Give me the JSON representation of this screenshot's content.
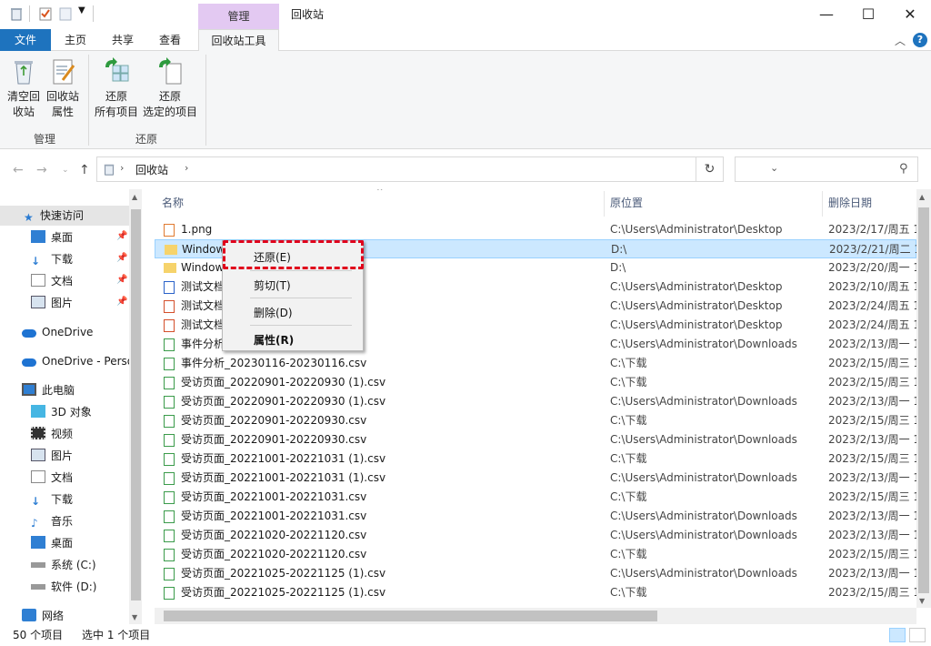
{
  "window": {
    "title": "回收站",
    "context_tab_header": "管理",
    "minimize": "—",
    "maximize": "☐",
    "close": "✕"
  },
  "ribbon_tabs": [
    {
      "label": "文件"
    },
    {
      "label": "主页"
    },
    {
      "label": "共享"
    },
    {
      "label": "查看"
    },
    {
      "label": "回收站工具"
    }
  ],
  "ribbon": {
    "empty_bin": [
      "清空回",
      "收站"
    ],
    "bin_props": [
      "回收站",
      "属性"
    ],
    "restore_all": [
      "还原",
      "所有项目"
    ],
    "restore_selected": [
      "还原",
      "选定的项目"
    ],
    "group_manage": "管理",
    "group_restore": "还原"
  },
  "address": {
    "crumb": "回收站"
  },
  "nav": {
    "quick_access": "快速访问",
    "desktop": "桌面",
    "downloads": "下载",
    "documents": "文档",
    "pictures": "图片",
    "onedrive": "OneDrive",
    "onedrive_personal": "OneDrive - Personal",
    "this_pc": "此电脑",
    "objects3d": "3D 对象",
    "videos": "视频",
    "pictures2": "图片",
    "documents2": "文档",
    "downloads2": "下载",
    "music": "音乐",
    "desktop2": "桌面",
    "drive_c": "系统 (C:)",
    "drive_d": "软件 (D:)",
    "network": "网络"
  },
  "columns": {
    "name": "名称",
    "location": "原位置",
    "date": "删除日期"
  },
  "files": [
    {
      "name": "1.png",
      "loc": "C:\\Users\\Administrator\\Desktop",
      "date": "2023/2/17/周五 1"
    },
    {
      "name": "Windows",
      "loc": "D:\\",
      "date": "2023/2/21/周二 1"
    },
    {
      "name": "Windows69",
      "loc": "D:\\",
      "date": "2023/2/20/周一 1"
    },
    {
      "name": "测试文档",
      "loc": "C:\\Users\\Administrator\\Desktop",
      "date": "2023/2/10/周五 1"
    },
    {
      "name": "测试文档",
      "loc": "C:\\Users\\Administrator\\Desktop",
      "date": "2023/2/24/周五 1"
    },
    {
      "name": "测试文档",
      "loc": "C:\\Users\\Administrator\\Desktop",
      "date": "2023/2/24/周五 1"
    },
    {
      "name": "事件分析",
      "loc": "C:\\Users\\Administrator\\Downloads",
      "date": "2023/2/13/周一 1"
    },
    {
      "name": "事件分析_20230116-20230116.csv",
      "loc": "C:\\下载",
      "date": "2023/2/15/周三 1"
    },
    {
      "name": "受访页面_20220901-20220930 (1).csv",
      "loc": "C:\\下载",
      "date": "2023/2/15/周三 1"
    },
    {
      "name": "受访页面_20220901-20220930 (1).csv",
      "loc": "C:\\Users\\Administrator\\Downloads",
      "date": "2023/2/13/周一 1"
    },
    {
      "name": "受访页面_20220901-20220930.csv",
      "loc": "C:\\下载",
      "date": "2023/2/15/周三 1"
    },
    {
      "name": "受访页面_20220901-20220930.csv",
      "loc": "C:\\Users\\Administrator\\Downloads",
      "date": "2023/2/13/周一 1"
    },
    {
      "name": "受访页面_20221001-20221031 (1).csv",
      "loc": "C:\\下载",
      "date": "2023/2/15/周三 1"
    },
    {
      "name": "受访页面_20221001-20221031 (1).csv",
      "loc": "C:\\Users\\Administrator\\Downloads",
      "date": "2023/2/13/周一 1"
    },
    {
      "name": "受访页面_20221001-20221031.csv",
      "loc": "C:\\下载",
      "date": "2023/2/15/周三 1"
    },
    {
      "name": "受访页面_20221001-20221031.csv",
      "loc": "C:\\Users\\Administrator\\Downloads",
      "date": "2023/2/13/周一 1"
    },
    {
      "name": "受访页面_20221020-20221120.csv",
      "loc": "C:\\Users\\Administrator\\Downloads",
      "date": "2023/2/13/周一 1"
    },
    {
      "name": "受访页面_20221020-20221120.csv",
      "loc": "C:\\下载",
      "date": "2023/2/15/周三 1"
    },
    {
      "name": "受访页面_20221025-20221125 (1).csv",
      "loc": "C:\\Users\\Administrator\\Downloads",
      "date": "2023/2/13/周一 1"
    },
    {
      "name": "受访页面_20221025-20221125 (1).csv",
      "loc": "C:\\下载",
      "date": "2023/2/15/周三 1"
    }
  ],
  "context_menu": {
    "restore": "还原(E)",
    "cut": "剪切(T)",
    "delete": "删除(D)",
    "properties": "属性(R)"
  },
  "status": {
    "count": "50 个项目",
    "selected": "选中 1 个项目"
  }
}
